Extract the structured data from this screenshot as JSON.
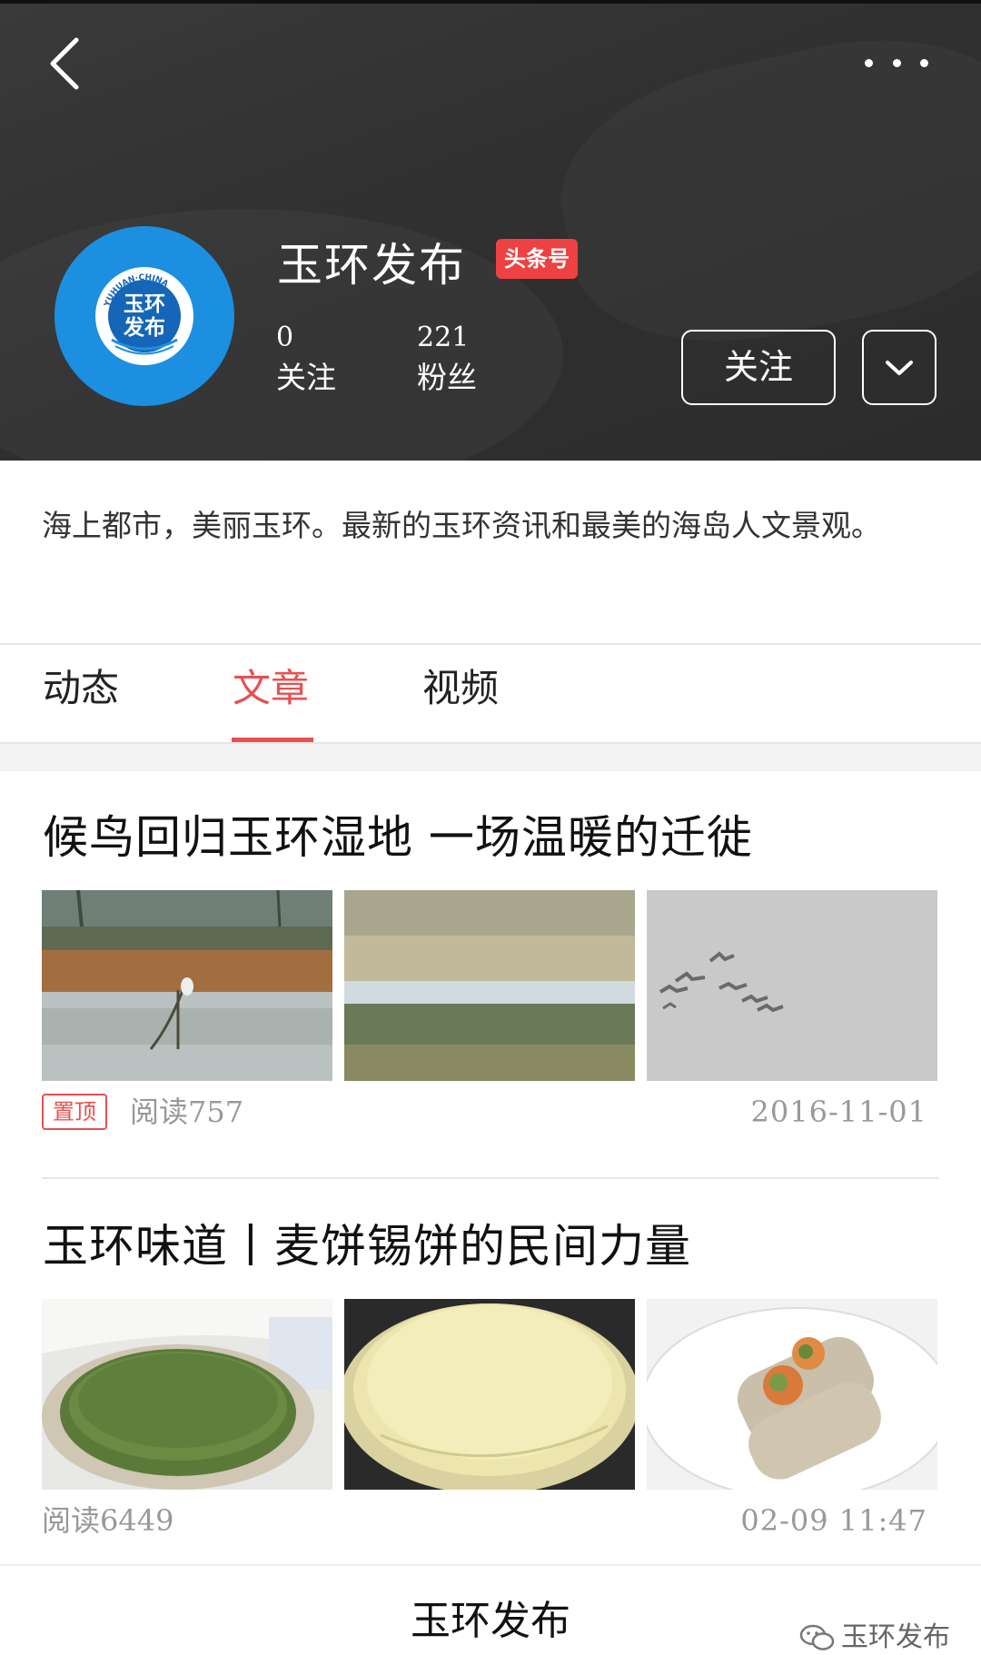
{
  "profile": {
    "name": "玉环发布",
    "badge": "头条号",
    "avatar_text_line1": "玉环",
    "avatar_text_line2": "发布",
    "avatar_ring_text": "YUHUAN·CHINA",
    "following_count": "0",
    "following_label": "关注",
    "fans_count": "221",
    "fans_label": "粉丝",
    "follow_button": "关注",
    "description": "海上都市，美丽玉环。最新的玉环资讯和最美的海岛人文景观。"
  },
  "tabs": [
    {
      "label": "动态",
      "active": false
    },
    {
      "label": "文章",
      "active": true
    },
    {
      "label": "视频",
      "active": false
    }
  ],
  "articles": [
    {
      "title": "候鸟回归玉环湿地  一场温暖的迁徙",
      "pinned_label": "置顶",
      "reads": "阅读757",
      "date": "2016-11-01"
    },
    {
      "title": "玉环味道丨麦饼锡饼的民间力量",
      "reads": "阅读6449",
      "date": "02-09  11:47"
    }
  ],
  "footer": {
    "title": "玉环发布",
    "watermark": "玉环发布"
  },
  "colors": {
    "accent": "#e8504f",
    "badge": "#f04142",
    "header_bg": "#333333",
    "avatar_blue": "#1c8fe0"
  },
  "icons": {
    "back": "back-chevron-icon",
    "more": "more-dots-icon",
    "expand": "chevron-down-icon",
    "watermark": "wechat-icon"
  }
}
